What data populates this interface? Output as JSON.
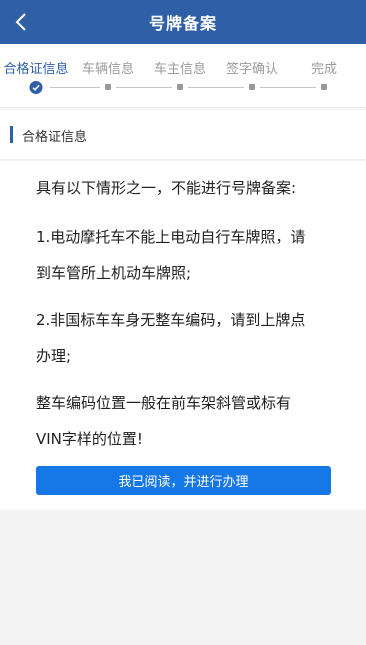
{
  "header": {
    "title": "号牌备案",
    "back_icon": "chevron-left-icon"
  },
  "steps": {
    "items": [
      {
        "label": "合格证信息",
        "state": "active"
      },
      {
        "label": "车辆信息",
        "state": "pending"
      },
      {
        "label": "车主信息",
        "state": "pending"
      },
      {
        "label": "签字确认",
        "state": "pending"
      },
      {
        "label": "完成",
        "state": "pending"
      }
    ],
    "active_color": "#2f5fa6",
    "inactive_color": "#9a9a9a"
  },
  "section": {
    "title": "合格证信息"
  },
  "content": {
    "intro": "具有以下情形之一，不能进行号牌备案:",
    "rule1_line1": "1.电动摩托车不能上电动自行车牌照，请",
    "rule1_line2": "到车管所上机动车牌照;",
    "rule2_line1": "2.非国标车车身无整车编码，请到上牌点",
    "rule2_line2": "办理;",
    "note_line1": "整车编码位置一般在前车架斜管或标有",
    "note_line2": "VIN字样的位置!"
  },
  "actions": {
    "confirm_label": "我已阅读，并进行办理"
  },
  "colors": {
    "brand": "#2f5fa6",
    "button": "#1677e6",
    "background": "#f4f4f4"
  }
}
